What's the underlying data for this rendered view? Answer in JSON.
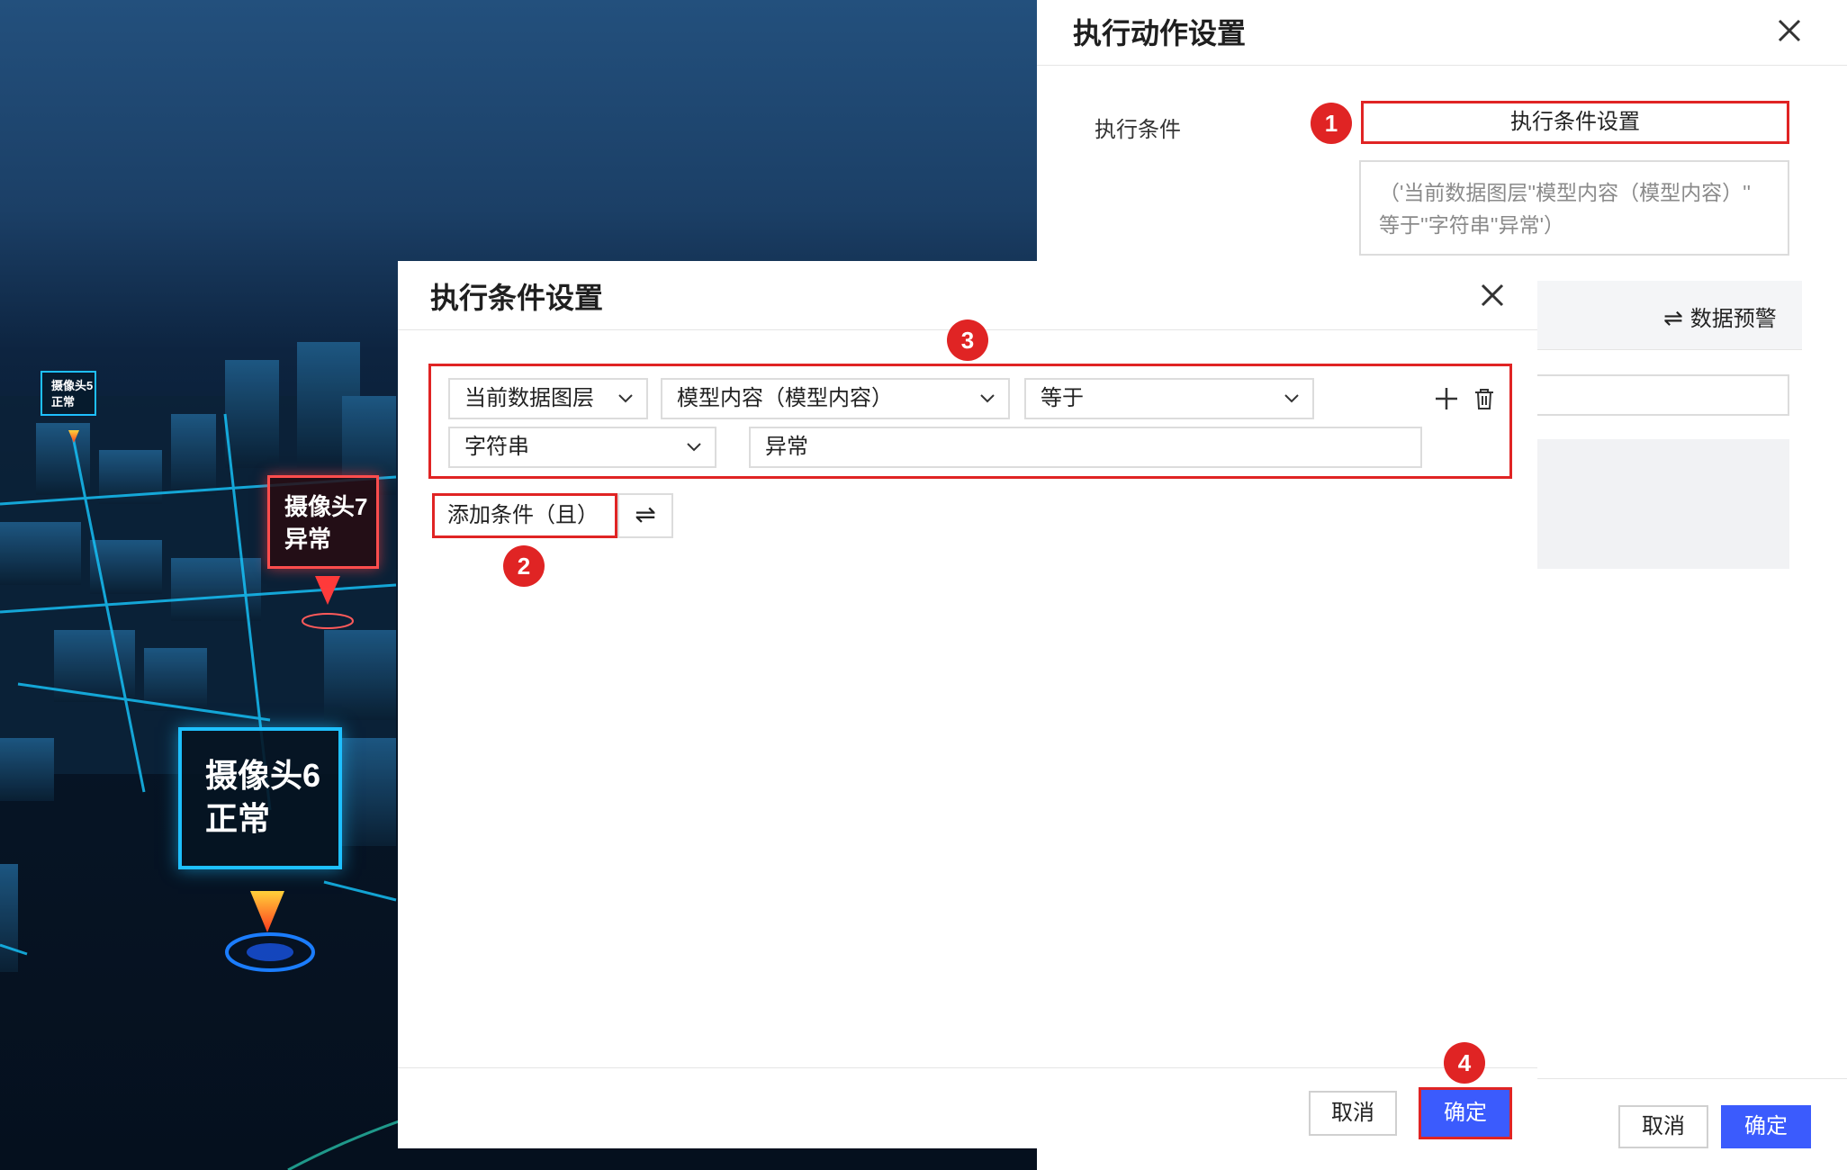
{
  "background_scene": {
    "cameras": [
      {
        "name": "摄像头5",
        "status": "正常"
      },
      {
        "name": "摄像头7",
        "status": "异常"
      },
      {
        "name": "摄像头6",
        "status": "正常"
      }
    ]
  },
  "action_panel": {
    "title": "执行动作设置",
    "condition_label": "执行条件",
    "condition_button": "执行条件设置",
    "condition_summary": "（'当前数据图层''模型内容（模型内容）'' 等于''字符串''异常'）",
    "tab_label": "数据预警",
    "cancel_label": "取消",
    "confirm_label": "确定"
  },
  "condition_dialog": {
    "title": "执行条件设置",
    "rule": {
      "layer_select": "当前数据图层",
      "field_select": "模型内容（模型内容）",
      "operator_select": "等于",
      "value_type_select": "字符串",
      "value_input": "异常"
    },
    "add_condition_label": "添加条件（且）",
    "toggle_glyph": "⇌",
    "cancel_label": "取消",
    "confirm_label": "确定"
  },
  "steps": [
    "1",
    "2",
    "3",
    "4"
  ],
  "colors": {
    "highlight": "#e02424",
    "primary": "#3b5bfd",
    "normal_marker": "#1ec0ff",
    "alarm_marker": "#ff4d4d"
  },
  "icons": [
    "close-icon",
    "chevron-down-icon",
    "plus-icon",
    "trash-icon",
    "swap-icon"
  ]
}
